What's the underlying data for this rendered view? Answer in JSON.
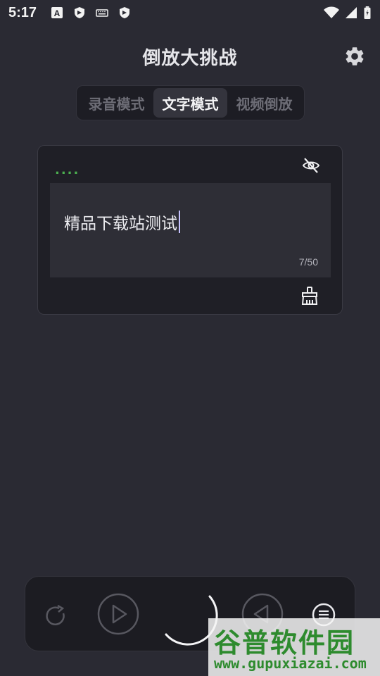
{
  "status_bar": {
    "time": "5:17",
    "left_icons": [
      "font-icon",
      "shield-icon",
      "keyboard-icon",
      "shield-icon"
    ],
    "right_icons": [
      "wifi-icon",
      "signal-icon",
      "battery-icon"
    ]
  },
  "header": {
    "title": "倒放大挑战",
    "settings_icon": "gear-icon"
  },
  "mode_tabs": {
    "items": [
      {
        "label": "录音模式",
        "active": false
      },
      {
        "label": "文字模式",
        "active": true
      },
      {
        "label": "视频倒放",
        "active": false
      }
    ]
  },
  "text_card": {
    "dots": "....",
    "visibility_icon": "eye-off-icon",
    "input_value": "精品下载站测试",
    "counter": "7/50",
    "clear_icon": "broom-icon"
  },
  "bottom_controls": {
    "items": [
      "replay-icon",
      "play-icon",
      "loading-spinner",
      "reverse-play-icon",
      "menu-icon"
    ]
  },
  "watermark": {
    "brand": "谷普软件园",
    "url": "www.gupuxiazai.com"
  },
  "colors": {
    "background": "#2a2a33",
    "card": "#1f1f26",
    "accent_green": "#4caf50",
    "caret": "#c5c2ff"
  }
}
